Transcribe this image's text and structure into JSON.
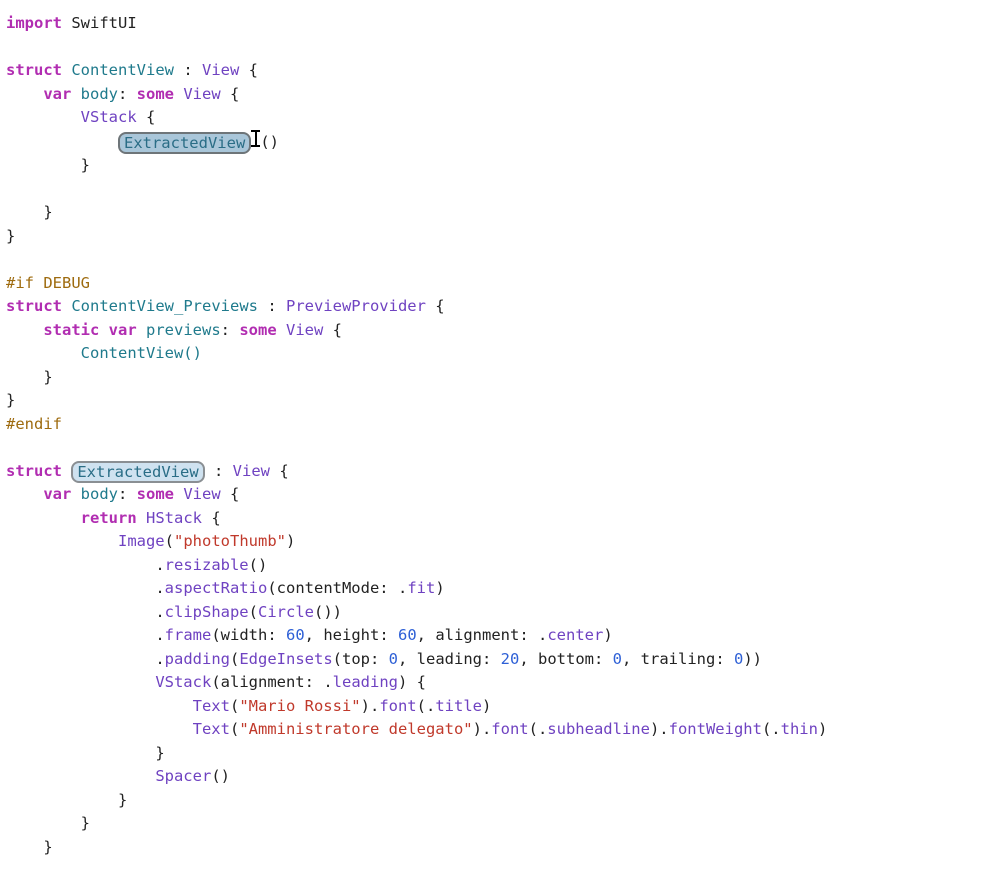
{
  "code": {
    "import_kw": "import",
    "swiftui": "SwiftUI",
    "struct_kw": "struct",
    "content_view": "ContentView",
    "colon": " : ",
    "view_type": "View",
    "brace_open": " {",
    "brace_close": "}",
    "var_kw": "var",
    "body_prop": "body",
    "some_kw": "some",
    "vstack": "VStack",
    "extracted_view_token": "ExtractedView",
    "parens_empty": "()",
    "hash_if_debug": "#if DEBUG",
    "previews_struct": "ContentView_Previews",
    "preview_provider": "PreviewProvider",
    "static_kw": "static",
    "previews_prop": "previews",
    "content_view_call": "ContentView()",
    "hash_endif": "#endif",
    "extracted_view_struct": "ExtractedView",
    "return_kw": "return",
    "hstack": "HStack",
    "image": "Image",
    "photo_thumb": "\"photoThumb\"",
    "dot": ".",
    "resizable": "resizable",
    "aspect_ratio": "aspectRatio",
    "content_mode_label": "contentMode: ",
    "fit": "fit",
    "clip_shape": "clipShape",
    "circle": "Circle",
    "frame": "frame",
    "width_label": "width: ",
    "num_60_a": "60",
    "height_label": ", height: ",
    "num_60_b": "60",
    "alignment_label": ", alignment: ",
    "center": "center",
    "padding": "padding",
    "edge_insets": "EdgeInsets",
    "top_label": "top: ",
    "num_0_a": "0",
    "leading_label": ", leading: ",
    "num_20": "20",
    "bottom_label": ", bottom: ",
    "num_0_b": "0",
    "trailing_label": ", trailing: ",
    "num_0_c": "0",
    "vstack2": "VStack",
    "alignment_init_label": "alignment: ",
    "leading": "leading",
    "text": "Text",
    "mario": "\"Mario Rossi\"",
    "font": "font",
    "title": "title",
    "amm": "\"Amministratore delegato\"",
    "subheadline": "subheadline",
    "font_weight": "fontWeight",
    "thin": "thin",
    "spacer": "Spacer"
  }
}
